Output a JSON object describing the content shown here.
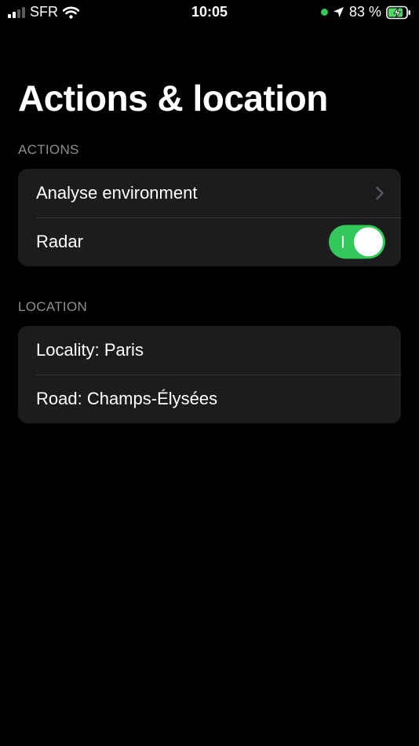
{
  "colors": {
    "background": "#000000",
    "group_background": "#1c1c1e",
    "separator": "#38383a",
    "section_header": "#8e8e93",
    "toggle_on": "#34c759",
    "battery_charge": "#4cd964"
  },
  "status_bar": {
    "carrier": "SFR",
    "time": "10:05",
    "battery": "83 %"
  },
  "page": {
    "title": "Actions & location"
  },
  "sections": {
    "actions": {
      "header": "ACTIONS",
      "analyse_label": "Analyse environment",
      "radar_label": "Radar",
      "radar_enabled": true
    },
    "location": {
      "header": "LOCATION",
      "locality": "Locality: Paris",
      "road": "Road: Champs-Élysées"
    }
  }
}
